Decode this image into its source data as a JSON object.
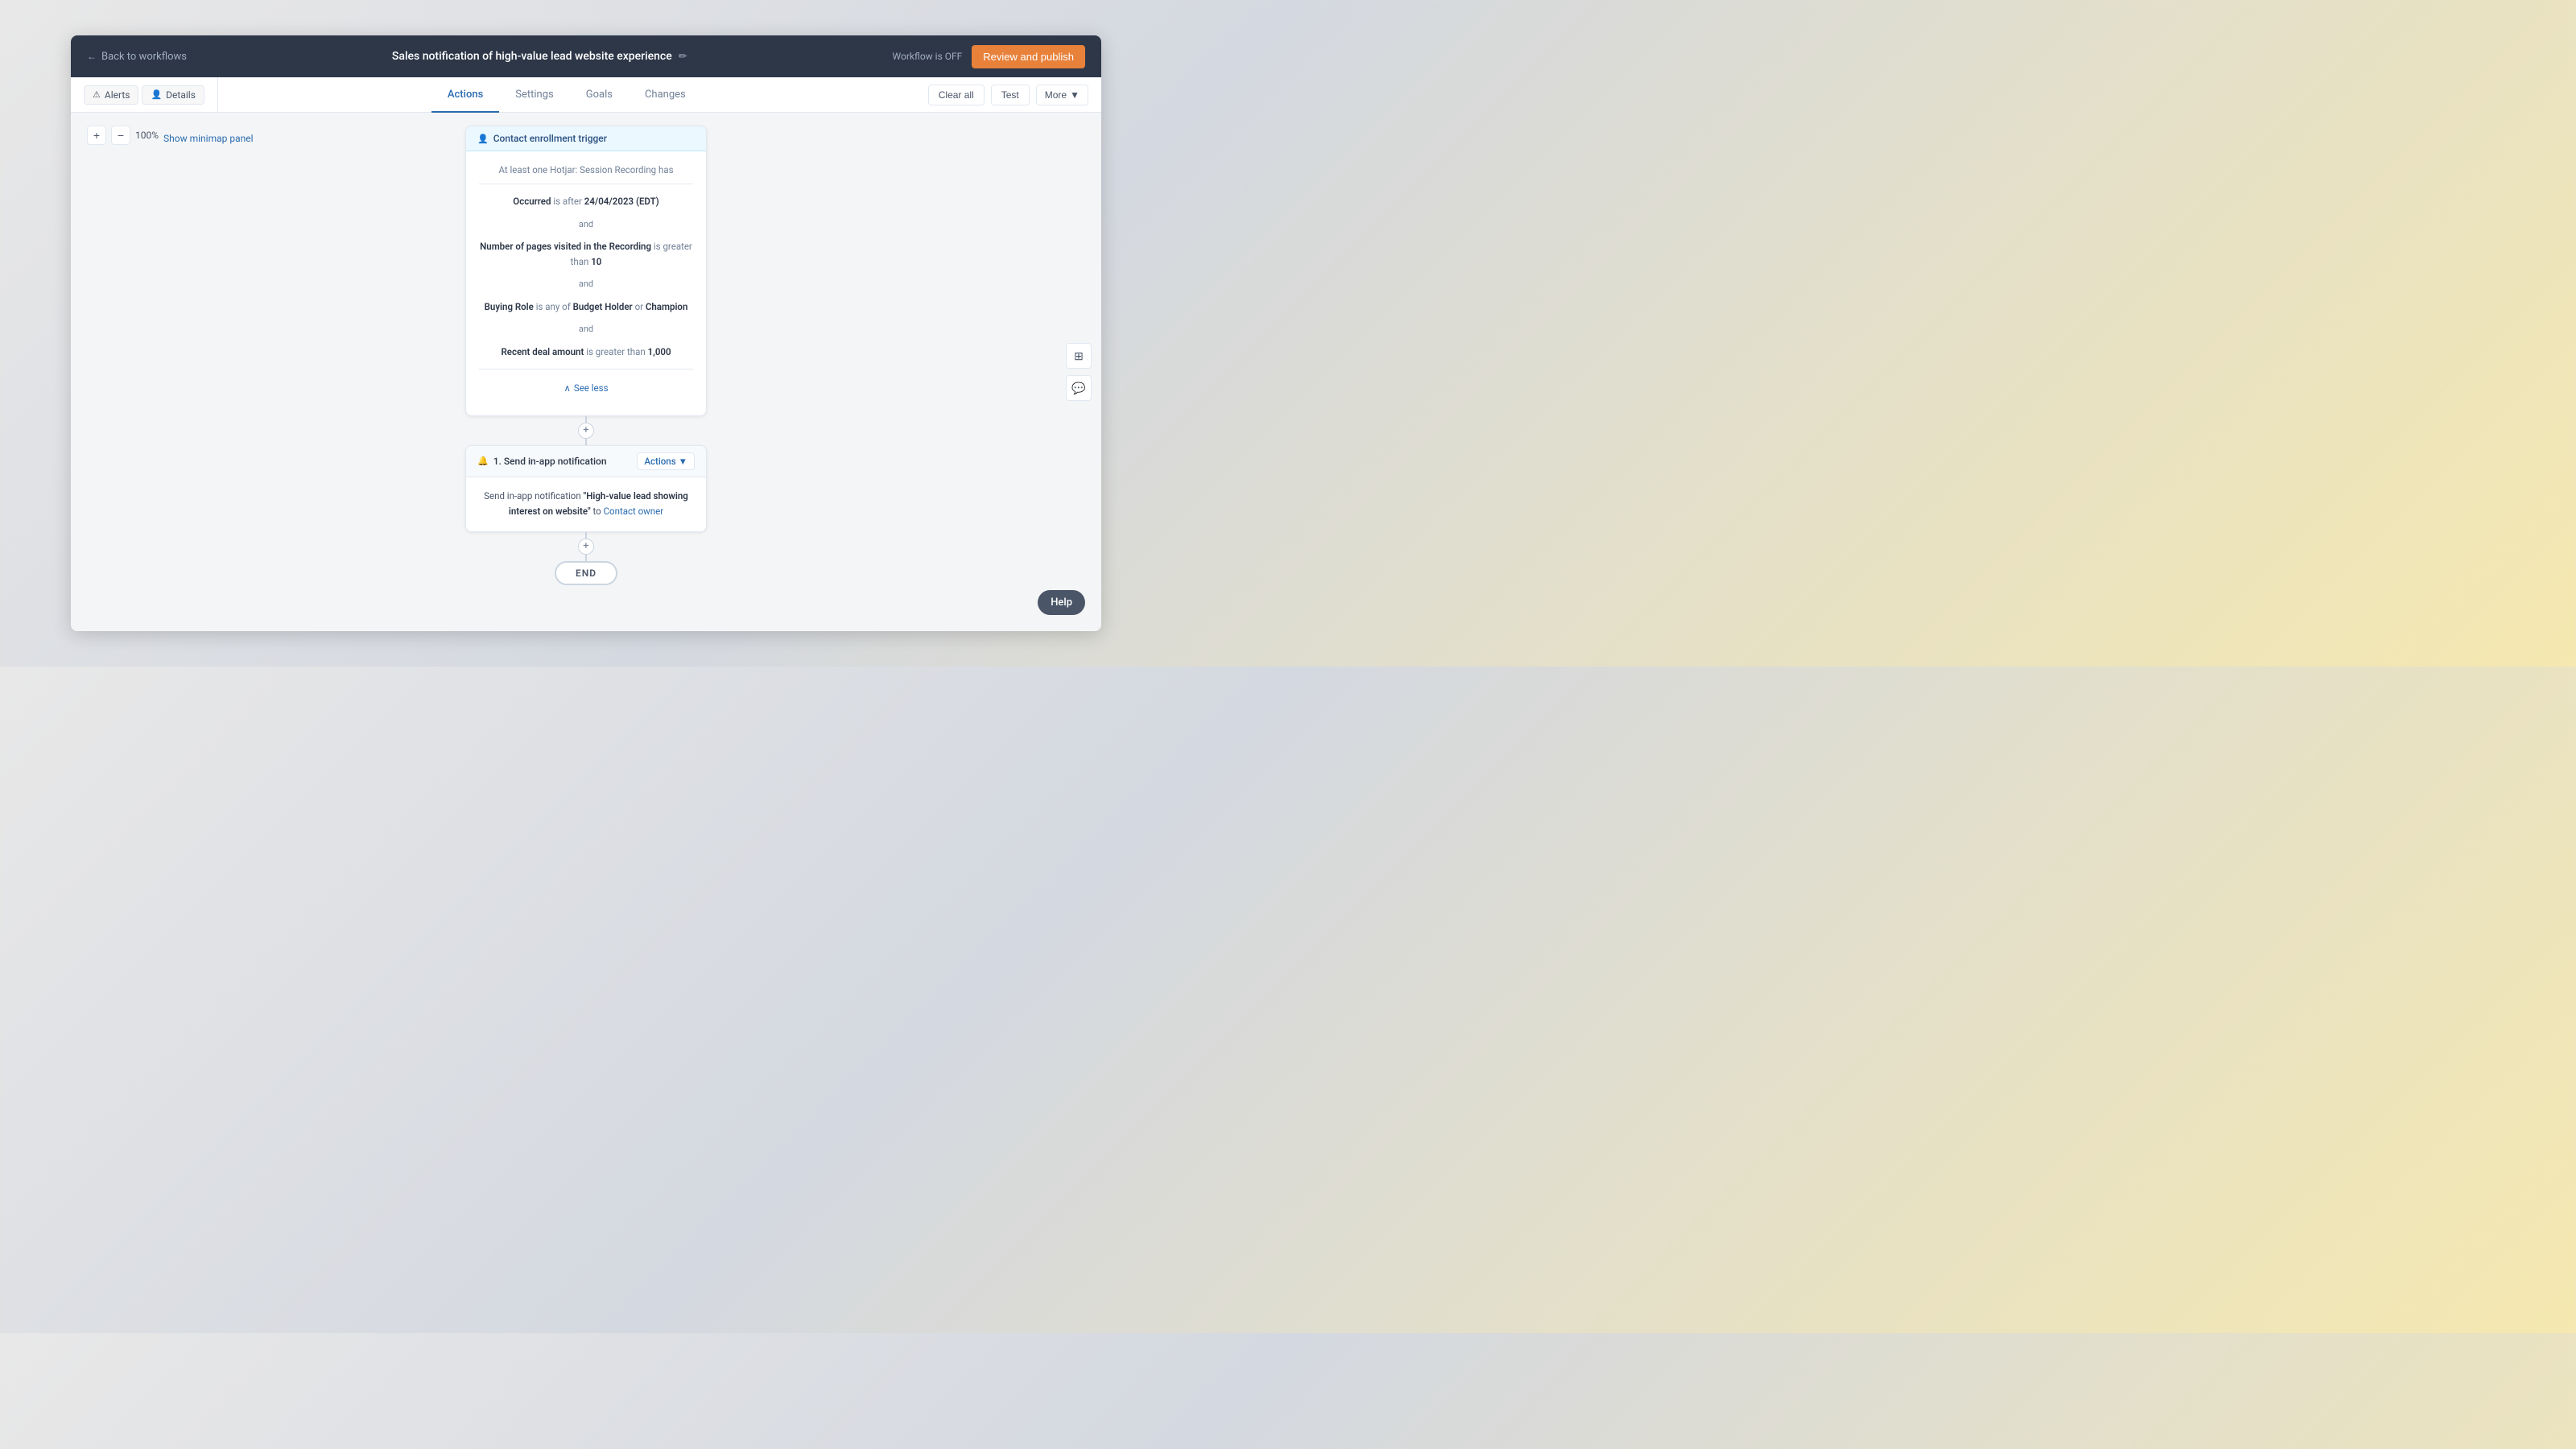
{
  "topNav": {
    "backLabel": "Back to workflows",
    "workflowTitle": "Sales notification of high-value lead website experience",
    "editIcon": "✏",
    "workflowStatus": "Workflow is OFF",
    "publishBtn": "Review and publish"
  },
  "secondaryNav": {
    "alertsBtn": "Alerts",
    "detailsBtn": "Details",
    "tabs": [
      {
        "label": "Actions",
        "active": true
      },
      {
        "label": "Settings",
        "active": false
      },
      {
        "label": "Goals",
        "active": false
      },
      {
        "label": "Changes",
        "active": false
      }
    ],
    "clearAllBtn": "Clear all",
    "testBtn": "Test",
    "moreBtn": "More"
  },
  "canvas": {
    "zoom": "100%",
    "showMinimap": "Show minimap panel"
  },
  "triggerCard": {
    "header": "Contact enrollment trigger",
    "introText": "At least one Hotjar: Session Recording has",
    "conditions": [
      {
        "prefix": "Occurred",
        "bold": "Occurred",
        "text": " is after ",
        "value": "24/04/2023 (EDT)"
      },
      {
        "separator": "and"
      },
      {
        "text": "Number of pages visited in the Recording",
        "suffix": " is greater than ",
        "value": "10"
      },
      {
        "separator": "and"
      },
      {
        "text": "Buying Role",
        "suffix": " is any of ",
        "value1": "Budget Holder",
        "mid": " or ",
        "value2": "Champion"
      },
      {
        "separator": "and"
      },
      {
        "text": "Recent deal amount",
        "suffix": " is greater than ",
        "value": "1,000"
      }
    ],
    "seeLess": "See less"
  },
  "actionCard": {
    "header": "1. Send in-app notification",
    "actionsBtn": "Actions",
    "bodyText": "Send in-app notification ",
    "notificationName": "\"High-value lead showing interest on website\"",
    "toText": " to ",
    "contactLink": "Contact owner"
  },
  "endNode": {
    "label": "END"
  },
  "helpBtn": "Help"
}
